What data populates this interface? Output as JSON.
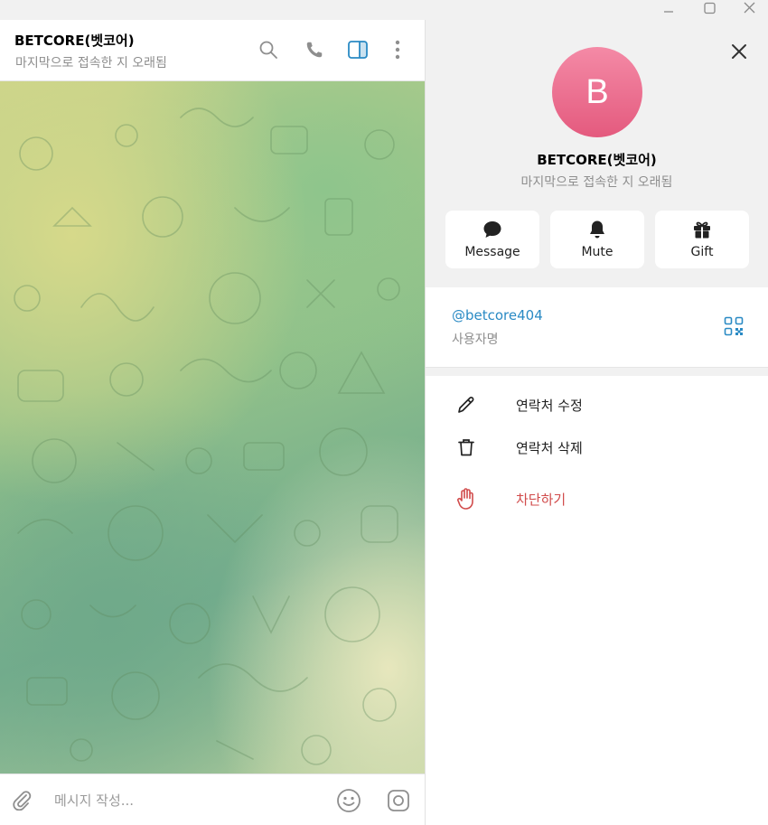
{
  "window": {
    "minimize_icon": "minimize-icon",
    "maximize_icon": "maximize-icon",
    "close_icon": "close-icon"
  },
  "chat": {
    "title": "BETCORE(벳코어)",
    "status": "마지막으로 접속한 지 오래됨",
    "header_icons": [
      "search-icon",
      "phone-icon",
      "sidebar-toggle-icon",
      "more-vertical-icon"
    ],
    "composer": {
      "placeholder": "메시지 작성...",
      "value": ""
    }
  },
  "profile": {
    "avatar_letter": "B",
    "name": "BETCORE(벳코어)",
    "status": "마지막으로 접속한 지 오래됨",
    "actions": [
      {
        "label": "Message",
        "icon": "message-bubble-icon"
      },
      {
        "label": "Mute",
        "icon": "bell-icon"
      },
      {
        "label": "Gift",
        "icon": "gift-icon"
      }
    ],
    "username": "@betcore404",
    "username_caption": "사용자명",
    "menu": [
      {
        "label": "연락처 수정",
        "icon": "pencil-icon"
      },
      {
        "label": "연락처 삭제",
        "icon": "trash-icon"
      },
      {
        "label": "차단하기",
        "icon": "hand-block-icon"
      }
    ]
  },
  "colors": {
    "accent": "#2a8ac4",
    "danger": "#d14b4b",
    "avatar_top": "#f48aa6",
    "avatar_bottom": "#e45a7e",
    "panel_bg": "#f1f1f1"
  }
}
